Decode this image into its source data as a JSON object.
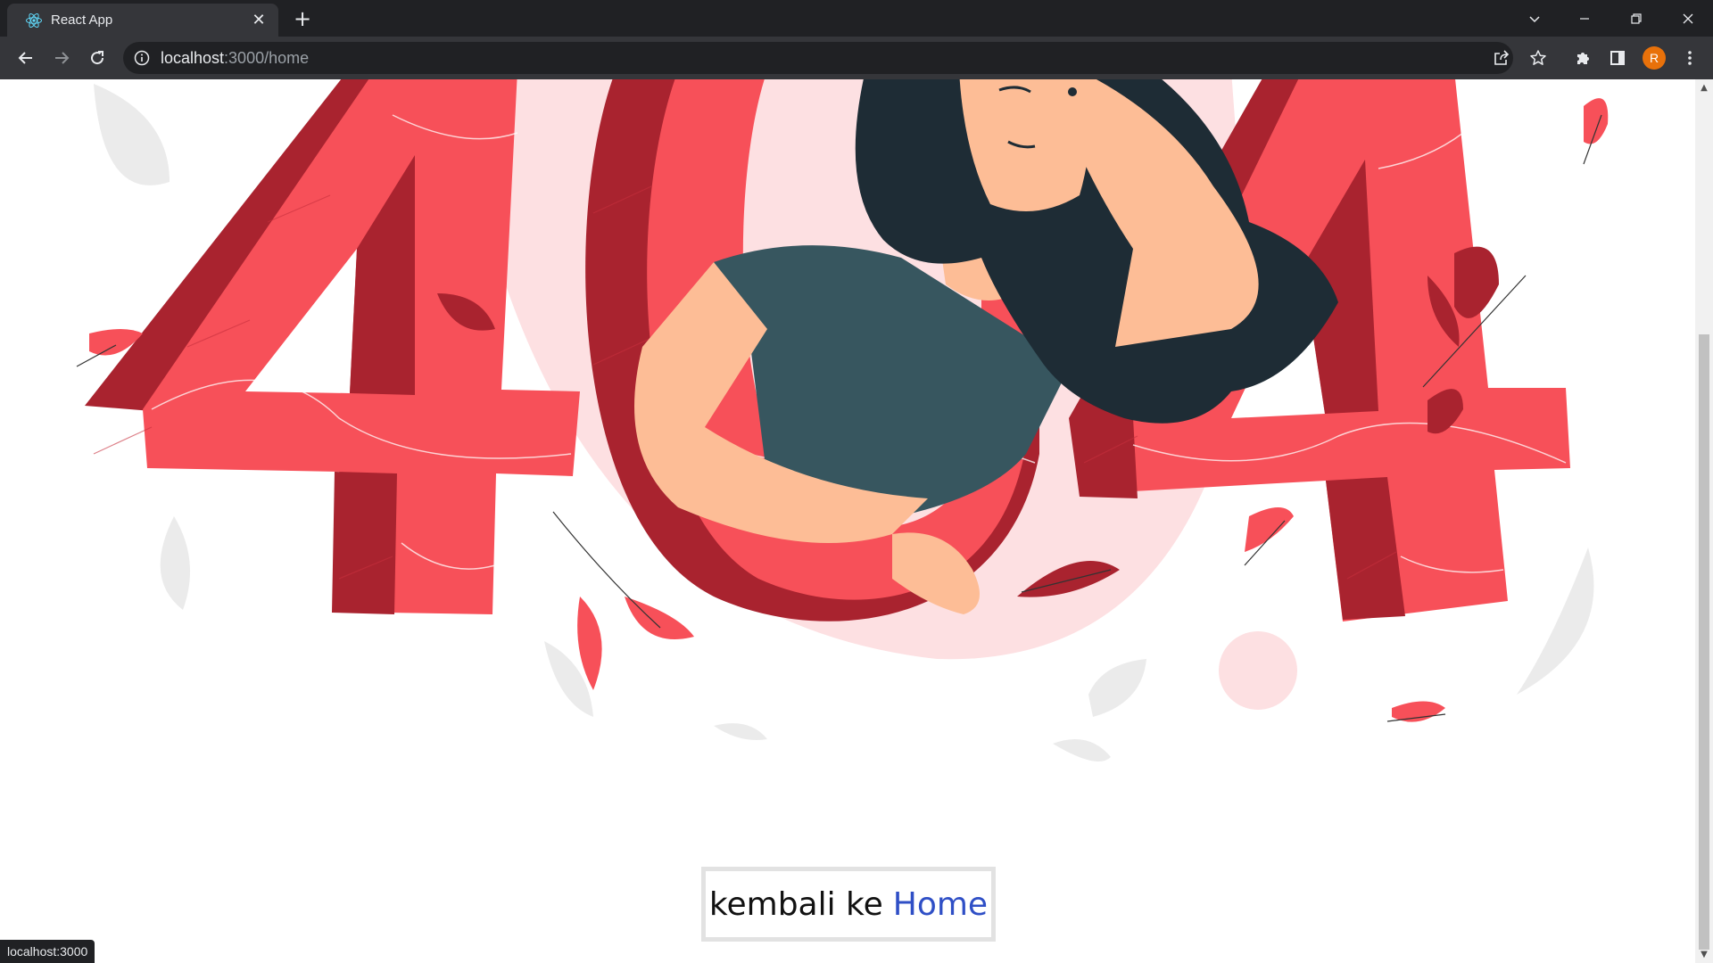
{
  "browser": {
    "tab_title": "React App",
    "new_tab_symbol": "+",
    "close_symbol": "✕",
    "url_host": "localhost",
    "url_rest": ":3000/home",
    "profile_initial": "R",
    "status_url": "localhost:3000"
  },
  "page": {
    "error_code": "404",
    "back_text": "kembali ke",
    "home_link": "Home"
  },
  "icons": {
    "favicon": "react-logo-icon",
    "back": "arrow-left-icon",
    "forward": "arrow-right-icon",
    "reload": "reload-icon",
    "info": "info-icon",
    "share": "share-icon",
    "bookmark": "star-icon",
    "extensions": "puzzle-icon",
    "side_panel": "side-panel-icon",
    "menu": "kebab-menu-icon"
  },
  "colors": {
    "chrome_dark": "#202124",
    "chrome_toolbar": "#35363a",
    "digit_red": "#f75059",
    "digit_dark_red": "#a9232f",
    "link_blue": "#2f4fc6",
    "avatar_orange": "#e8710a"
  }
}
